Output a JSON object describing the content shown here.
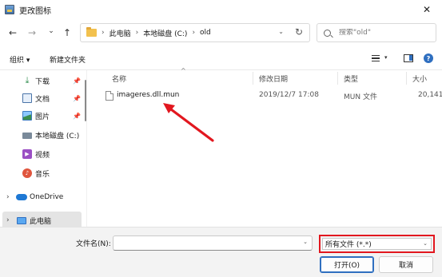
{
  "window": {
    "title": "更改图标",
    "close_glyph": "✕"
  },
  "nav": {
    "back": "←",
    "forward": "→",
    "recent": "⌄",
    "up": "↑"
  },
  "address": {
    "crumbs": [
      "此电脑",
      "本地磁盘 (C:)",
      "old"
    ],
    "separator": "›",
    "dropdown_glyph": "⌄",
    "refresh_glyph": "↻"
  },
  "search": {
    "placeholder": "搜索\"old\""
  },
  "toolbar": {
    "organize": "组织 ▾",
    "new_folder": "新建文件夹",
    "view_dropdown": "▾",
    "help": "?"
  },
  "sidebar": {
    "items": [
      {
        "label": "下载",
        "icon": "download-icon",
        "pinned": true
      },
      {
        "label": "文档",
        "icon": "document-icon",
        "pinned": true
      },
      {
        "label": "图片",
        "icon": "pictures-icon",
        "pinned": true
      },
      {
        "label": "本地磁盘 (C:)",
        "icon": "disk-icon",
        "pinned": false
      },
      {
        "label": "视频",
        "icon": "video-icon",
        "pinned": false
      },
      {
        "label": "音乐",
        "icon": "music-icon",
        "pinned": false
      },
      {
        "label": "OneDrive",
        "icon": "cloud-icon",
        "pinned": false
      },
      {
        "label": "此电脑",
        "icon": "computer-icon",
        "pinned": false,
        "selected": true
      }
    ],
    "pin_glyph": "📌",
    "expand_glyph": "›",
    "video_glyph": "▶",
    "music_glyph": "♪",
    "download_glyph": "⤓"
  },
  "filelist": {
    "columns": [
      "名称",
      "修改日期",
      "类型",
      "大小"
    ],
    "sort_caret": "^",
    "rows": [
      {
        "name": "imageres.dll.mun",
        "modified": "2019/12/7 17:08",
        "type": "MUN 文件",
        "size": "20,141"
      }
    ]
  },
  "bottom": {
    "filename_label": "文件名(N):",
    "filename_value": "",
    "filter_value": "所有文件 (*.*)",
    "open": "打开(O)",
    "cancel": "取消",
    "dropdown_glyph": "⌄"
  },
  "colors": {
    "highlight": "#e2171f",
    "accent": "#2f6fc0"
  }
}
